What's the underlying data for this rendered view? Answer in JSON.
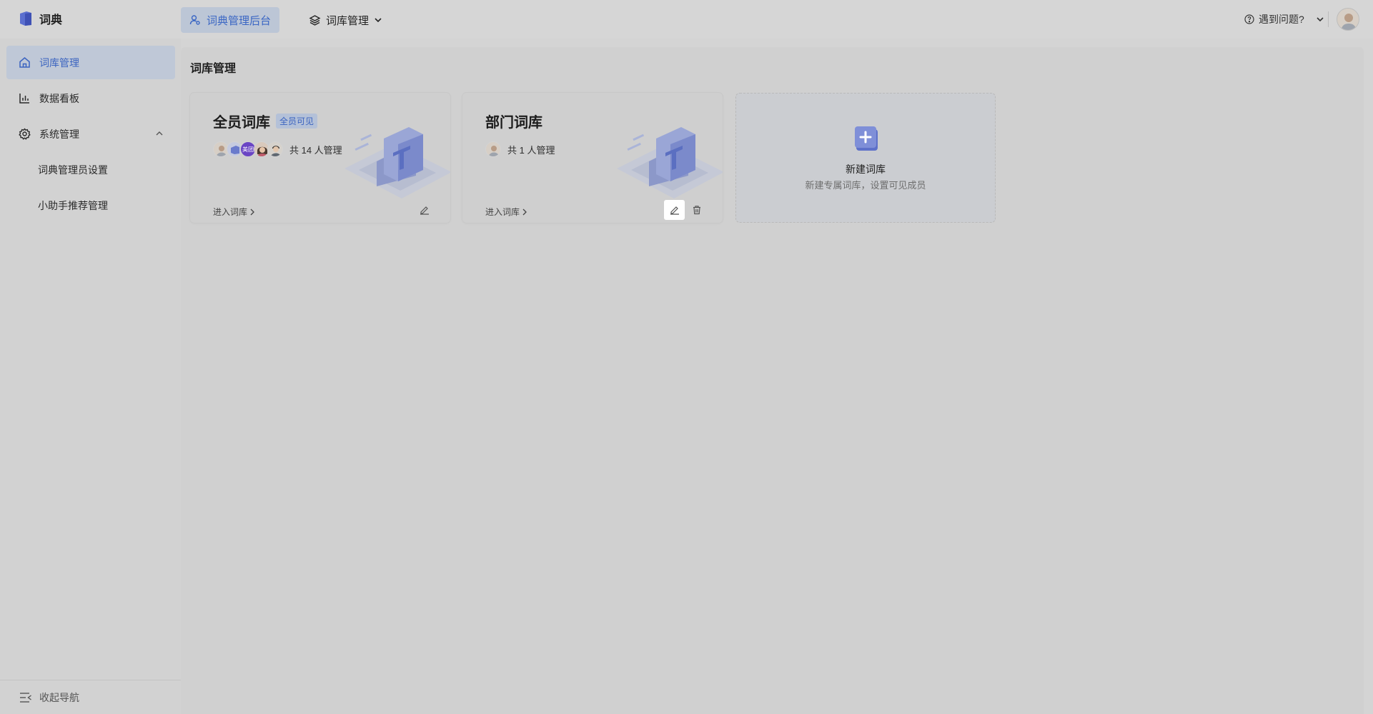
{
  "app": {
    "name": "词典"
  },
  "header": {
    "tab_admin": "词典管理后台",
    "tab_library": "词库管理",
    "help": "遇到问题?"
  },
  "sidebar": {
    "items": [
      {
        "label": "词库管理",
        "icon": "home-icon"
      },
      {
        "label": "数据看板",
        "icon": "bar-chart-icon"
      },
      {
        "label": "系统管理",
        "icon": "gear-icon"
      },
      {
        "label": "词典管理员设置"
      },
      {
        "label": "小助手推荐管理"
      }
    ],
    "collapse": "收起导航"
  },
  "main": {
    "title": "词库管理",
    "cards": [
      {
        "title": "全员词库",
        "badge": "全员可见",
        "members": "共 14 人管理",
        "enter": "进入词库",
        "avatar_label": "美团"
      },
      {
        "title": "部门词库",
        "members": "共 1 人管理",
        "enter": "进入词库"
      }
    ],
    "add_card": {
      "title": "新建词库",
      "subtitle": "新建专属词库，设置可见成员"
    }
  },
  "colors": {
    "accent": "#3b64c0",
    "active_bg": "#bfc8d7"
  }
}
